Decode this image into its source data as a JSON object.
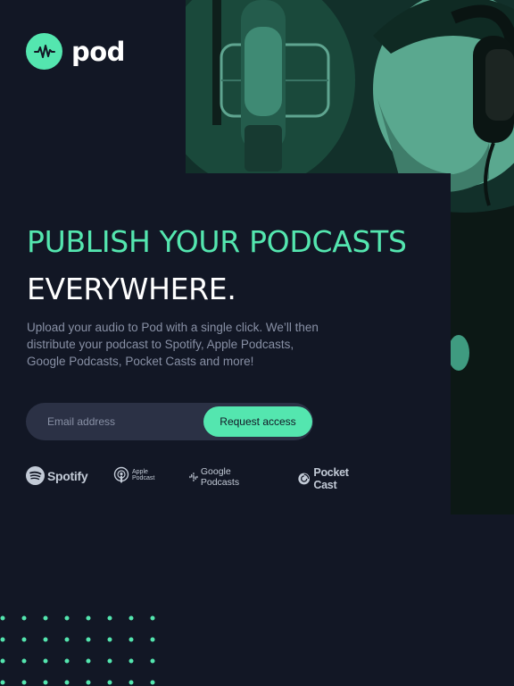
{
  "brand": {
    "name": "pod"
  },
  "hero": {
    "headline_line1": "PUBLISH YOUR PODCASTS",
    "headline_line2": "EVERYWHERE.",
    "description": "Upload your audio to Pod with a single click. We’ll then distribute your podcast to Spotify, Apple Podcasts, Google Podcasts, Pocket Casts and more!"
  },
  "form": {
    "email_placeholder": "Email address",
    "submit_label": "Request access"
  },
  "platforms": [
    {
      "label": "Spotify",
      "icon": "spotify-icon"
    },
    {
      "label_line1": "Apple",
      "label_line2": "Podcast",
      "icon": "apple-podcasts-icon"
    },
    {
      "label": "Google Podcasts",
      "icon": "google-podcasts-icon"
    },
    {
      "label": "Pocket Cast",
      "icon": "pocket-casts-icon"
    }
  ],
  "colors": {
    "background": "#121725",
    "accent": "#54e6af",
    "text_primary": "#ffffff",
    "text_muted": "#8890a5",
    "input_bg": "#2b3145"
  }
}
